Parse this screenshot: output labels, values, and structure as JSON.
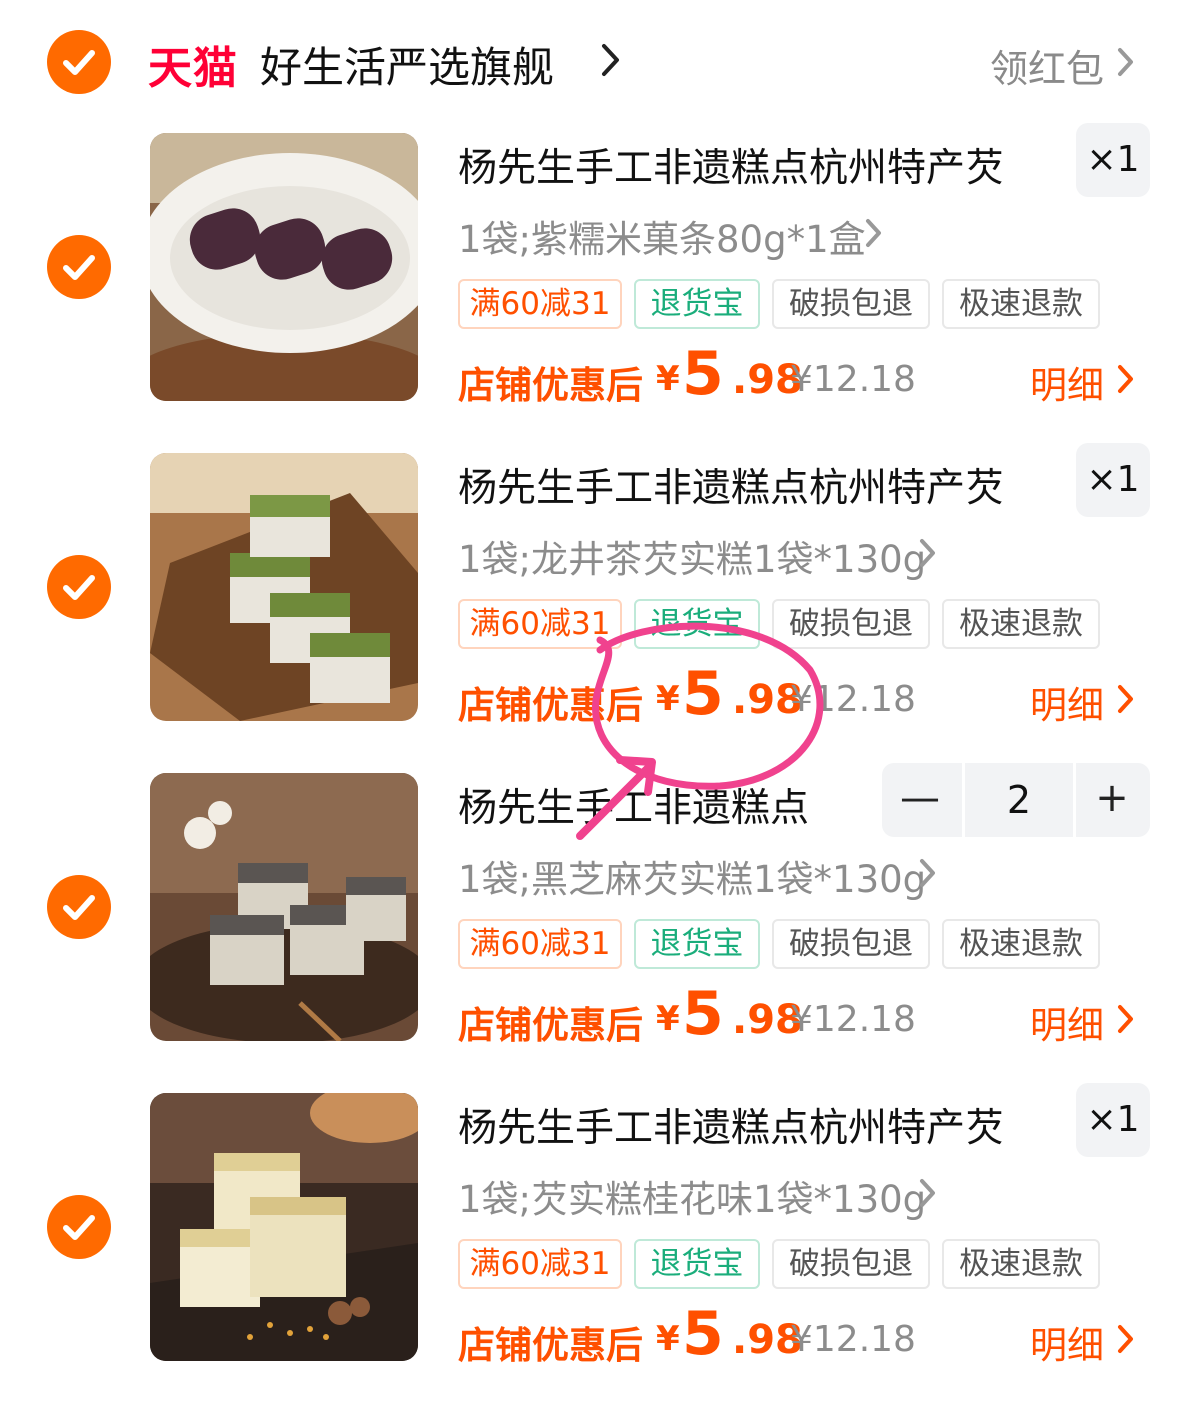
{
  "header": {
    "brand": "天猫",
    "shop_name": "好生活严选旗舰",
    "coupon_label": "领红包"
  },
  "colors": {
    "accent": "#ff5000",
    "check": "#ff6a00",
    "brand": "#ff0036",
    "safe": "#1aad7b"
  },
  "items": [
    {
      "title": "杨先生手工非遗糕点杭州特产芡",
      "sku": "1袋;紫糯米菓条80g*1盒",
      "quantity": "×1",
      "tags": [
        "满60减31",
        "退货宝",
        "破损包退",
        "极速退款"
      ],
      "price_label": "店铺优惠后",
      "currency": "¥",
      "price_int": "5",
      "price_dec": ".98",
      "original_price": "¥12.18",
      "detail_label": "明细"
    },
    {
      "title": "杨先生手工非遗糕点杭州特产芡",
      "sku": "1袋;龙井茶芡实糕1袋*130g",
      "quantity": "×1",
      "tags": [
        "满60减31",
        "退货宝",
        "破损包退",
        "极速退款"
      ],
      "price_label": "店铺优惠后",
      "currency": "¥",
      "price_int": "5",
      "price_dec": ".98",
      "original_price": "¥12.18",
      "detail_label": "明细"
    },
    {
      "title": "杨先生手工非遗糕点",
      "sku": "1袋;黑芝麻芡实糕1袋*130g",
      "quantity_value": "2",
      "minus": "—",
      "plus": "+",
      "tags": [
        "满60减31",
        "退货宝",
        "破损包退",
        "极速退款"
      ],
      "price_label": "店铺优惠后",
      "currency": "¥",
      "price_int": "5",
      "price_dec": ".98",
      "original_price": "¥12.18",
      "detail_label": "明细"
    },
    {
      "title": "杨先生手工非遗糕点杭州特产芡",
      "sku": "1袋;芡实糕桂花味1袋*130g",
      "quantity": "×1",
      "tags": [
        "满60减31",
        "退货宝",
        "破损包退",
        "极速退款"
      ],
      "price_label": "店铺优惠后",
      "currency": "¥",
      "price_int": "5",
      "price_dec": ".98",
      "original_price": "¥12.18",
      "detail_label": "明细"
    }
  ]
}
